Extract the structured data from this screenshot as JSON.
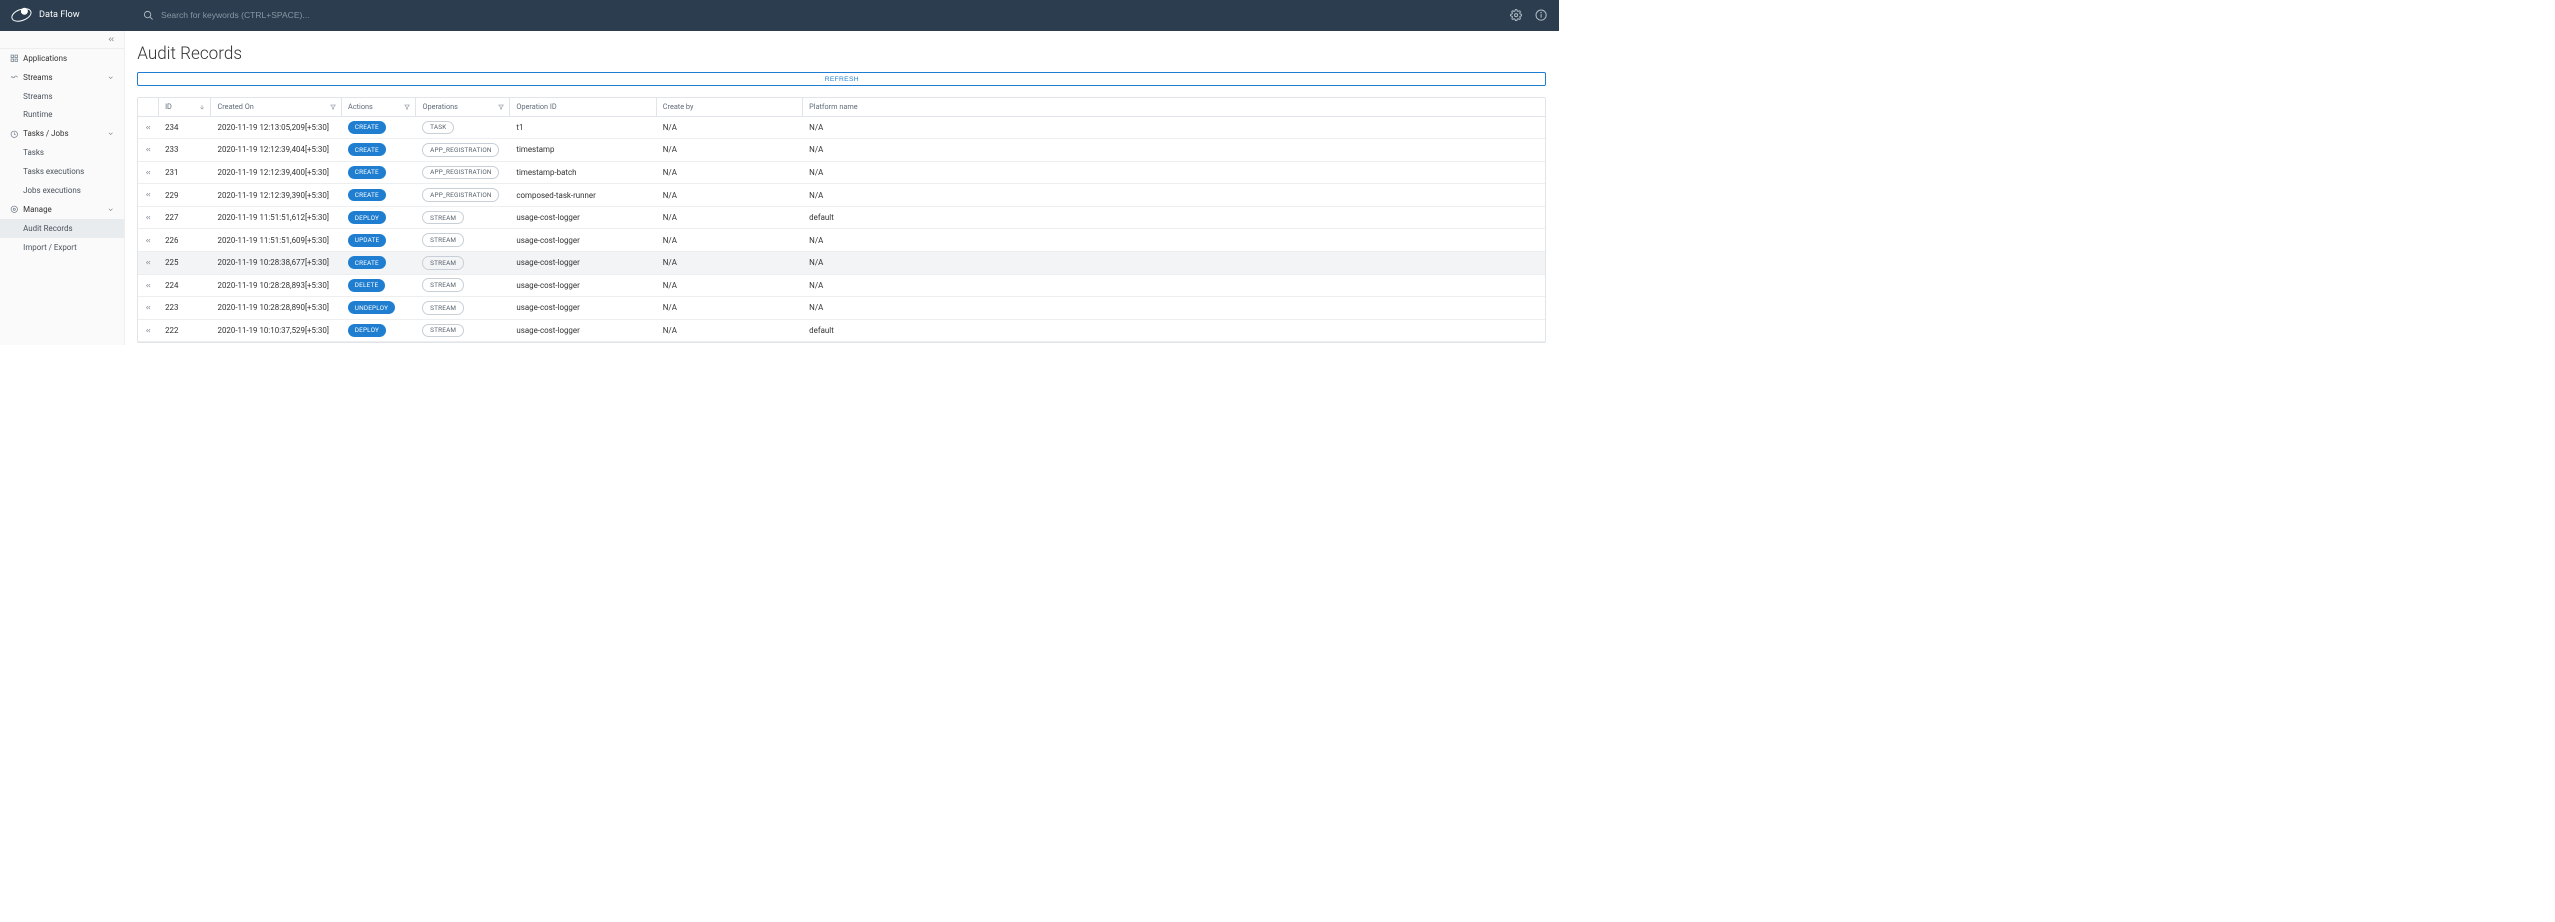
{
  "header": {
    "app_title": "Data Flow",
    "search_placeholder": "Search for keywords (CTRL+SPACE)..."
  },
  "sidebar": {
    "collapse_tooltip": "Collapse",
    "sections": [
      {
        "label": "Applications",
        "icon": "grid-icon",
        "type": "item"
      },
      {
        "label": "Streams",
        "icon": "streams-icon",
        "type": "section",
        "children": [
          {
            "label": "Streams"
          },
          {
            "label": "Runtime"
          }
        ]
      },
      {
        "label": "Tasks / Jobs",
        "icon": "jobs-icon",
        "type": "section",
        "children": [
          {
            "label": "Tasks"
          },
          {
            "label": "Tasks executions"
          },
          {
            "label": "Jobs executions"
          }
        ]
      },
      {
        "label": "Manage",
        "icon": "manage-icon",
        "type": "section",
        "children": [
          {
            "label": "Audit Records",
            "active": true
          },
          {
            "label": "Import / Export"
          }
        ]
      }
    ]
  },
  "main": {
    "page_title": "Audit Records",
    "refresh_label": "REFRESH",
    "columns": {
      "id": "ID",
      "created_on": "Created On",
      "actions": "Actions",
      "operations": "Operations",
      "operation_id": "Operation ID",
      "create_by": "Create by",
      "platform_name": "Platform name"
    },
    "rows": [
      {
        "id": "234",
        "created_on": "2020-11-19 12:13:05,209[+5:30]",
        "action": "CREATE",
        "operation": "TASK",
        "operation_id": "t1",
        "create_by": "N/A",
        "platform_name": "N/A"
      },
      {
        "id": "233",
        "created_on": "2020-11-19 12:12:39,404[+5:30]",
        "action": "CREATE",
        "operation": "APP_REGISTRATION",
        "operation_id": "timestamp",
        "create_by": "N/A",
        "platform_name": "N/A"
      },
      {
        "id": "231",
        "created_on": "2020-11-19 12:12:39,400[+5:30]",
        "action": "CREATE",
        "operation": "APP_REGISTRATION",
        "operation_id": "timestamp-batch",
        "create_by": "N/A",
        "platform_name": "N/A"
      },
      {
        "id": "229",
        "created_on": "2020-11-19 12:12:39,390[+5:30]",
        "action": "CREATE",
        "operation": "APP_REGISTRATION",
        "operation_id": "composed-task-runner",
        "create_by": "N/A",
        "platform_name": "N/A"
      },
      {
        "id": "227",
        "created_on": "2020-11-19 11:51:51,612[+5:30]",
        "action": "DEPLOY",
        "operation": "STREAM",
        "operation_id": "usage-cost-logger",
        "create_by": "N/A",
        "platform_name": "default"
      },
      {
        "id": "226",
        "created_on": "2020-11-19 11:51:51,609[+5:30]",
        "action": "UPDATE",
        "operation": "STREAM",
        "operation_id": "usage-cost-logger",
        "create_by": "N/A",
        "platform_name": "N/A"
      },
      {
        "id": "225",
        "created_on": "2020-11-19 10:28:38,677[+5:30]",
        "action": "CREATE",
        "operation": "STREAM",
        "operation_id": "usage-cost-logger",
        "create_by": "N/A",
        "platform_name": "N/A",
        "hover": true
      },
      {
        "id": "224",
        "created_on": "2020-11-19 10:28:28,893[+5:30]",
        "action": "DELETE",
        "operation": "STREAM",
        "operation_id": "usage-cost-logger",
        "create_by": "N/A",
        "platform_name": "N/A"
      },
      {
        "id": "223",
        "created_on": "2020-11-19 10:28:28,890[+5:30]",
        "action": "UNDEPLOY",
        "operation": "STREAM",
        "operation_id": "usage-cost-logger",
        "create_by": "N/A",
        "platform_name": "N/A"
      },
      {
        "id": "222",
        "created_on": "2020-11-19 10:10:37,529[+5:30]",
        "action": "DEPLOY",
        "operation": "STREAM",
        "operation_id": "usage-cost-logger",
        "create_by": "N/A",
        "platform_name": "default"
      }
    ]
  }
}
